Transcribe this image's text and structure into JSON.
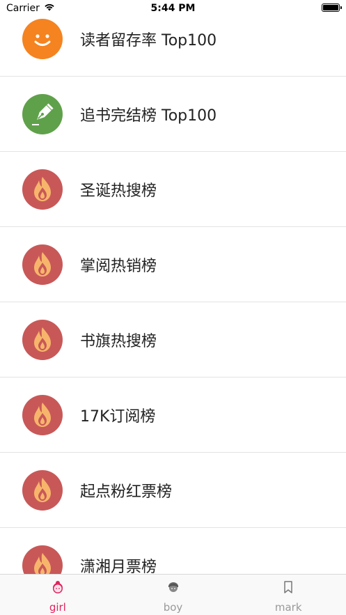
{
  "status_bar": {
    "carrier": "Carrier",
    "time": "5:44 PM"
  },
  "list": [
    {
      "label": "读者留存率 Top100",
      "icon": "smiley-face-icon",
      "color": "#f58320"
    },
    {
      "label": "追书完结榜 Top100",
      "icon": "fountain-pen-icon",
      "color": "#5fa14a"
    },
    {
      "label": "圣诞热搜榜",
      "icon": "flame-icon",
      "color": "#c85858"
    },
    {
      "label": "掌阅热销榜",
      "icon": "flame-icon",
      "color": "#c85858"
    },
    {
      "label": "书旗热搜榜",
      "icon": "flame-icon",
      "color": "#c85858"
    },
    {
      "label": "17K订阅榜",
      "icon": "flame-icon",
      "color": "#c85858"
    },
    {
      "label": "起点粉红票榜",
      "icon": "flame-icon",
      "color": "#c85858"
    },
    {
      "label": "潇湘月票榜",
      "icon": "flame-icon",
      "color": "#c85858"
    }
  ],
  "tabs": [
    {
      "label": "girl",
      "icon": "girl-face-icon",
      "active": true
    },
    {
      "label": "boy",
      "icon": "boy-face-icon",
      "active": false
    },
    {
      "label": "mark",
      "icon": "bookmark-icon",
      "active": false
    }
  ],
  "colors": {
    "accent": "#e0245e",
    "inactive_tab": "#999999",
    "divider": "#e3e3e3"
  }
}
